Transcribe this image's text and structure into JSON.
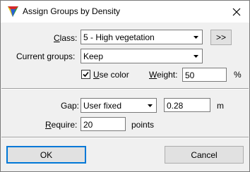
{
  "window": {
    "title": "Assign Groups by Density",
    "icons": {
      "app": "app-logo-icon",
      "close": "close-icon"
    }
  },
  "class_field": {
    "label_prefix": "",
    "label_underline": "C",
    "label_rest": "lass:",
    "value": "5 - High vegetation",
    "browse_label": ">>"
  },
  "current_groups": {
    "label": "Current groups:",
    "value": "Keep"
  },
  "use_color": {
    "label_underline": "U",
    "label_rest": "se color",
    "checked": true
  },
  "weight": {
    "label_underline": "W",
    "label_rest": "eight:",
    "value": "50",
    "unit": "%"
  },
  "gap": {
    "label": "Gap:",
    "mode": "User fixed",
    "value": "0.28",
    "unit": "m"
  },
  "require": {
    "label_underline": "R",
    "label_rest": "equire:",
    "value": "20",
    "unit": "points"
  },
  "buttons": {
    "ok": "OK",
    "cancel": "Cancel"
  }
}
